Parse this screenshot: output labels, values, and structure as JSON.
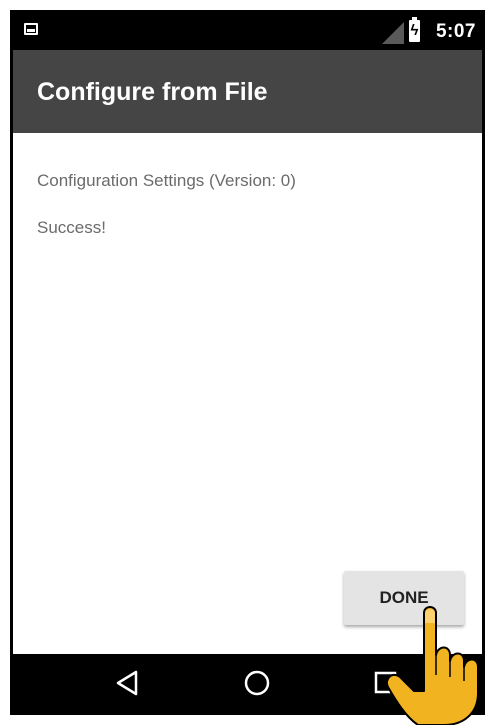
{
  "status_bar": {
    "time": "5:07",
    "icons": [
      "image-notification-icon",
      "signal-icon",
      "battery-charging-icon"
    ]
  },
  "action_bar": {
    "title": "Configure from File"
  },
  "content": {
    "line1": "Configuration Settings (Version: 0)",
    "line2": "Success!"
  },
  "actions": {
    "done_label": "DONE"
  },
  "nav_bar": {
    "icons": [
      "back-icon",
      "home-icon",
      "recents-icon"
    ]
  },
  "overlay": {
    "icon": "pointing-hand-icon"
  },
  "colors": {
    "status_bar": "#000000",
    "action_bar": "#454545",
    "text": "#6b6b6b",
    "button": "#e4e4e4",
    "hand": "#f2b320"
  }
}
